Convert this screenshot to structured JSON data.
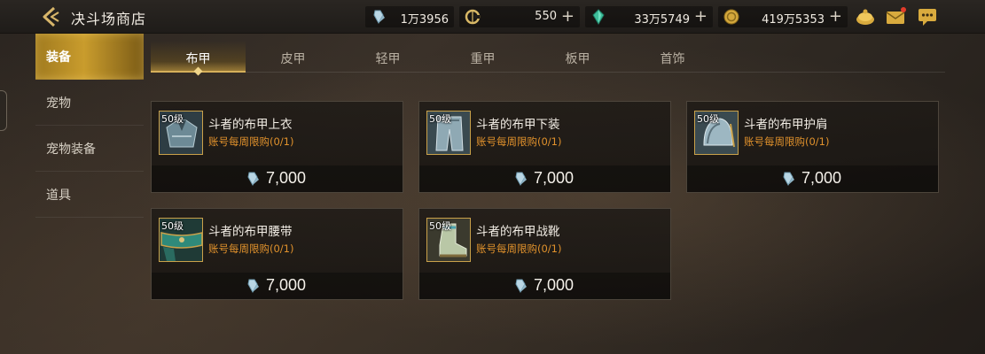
{
  "header": {
    "title": "决斗场商店",
    "currencies": [
      {
        "icon": "crystal-icon",
        "value": "1万3956",
        "plus": false
      },
      {
        "icon": "coin-c-icon",
        "value": "550",
        "plus": true
      },
      {
        "icon": "gem-icon",
        "value": "33万5749",
        "plus": true
      },
      {
        "icon": "gold-icon",
        "value": "419万5353",
        "plus": true
      }
    ]
  },
  "sidebar": {
    "items": [
      {
        "label": "装备",
        "active": true
      },
      {
        "label": "宠物",
        "active": false
      },
      {
        "label": "宠物装备",
        "active": false
      },
      {
        "label": "道具",
        "active": false
      }
    ]
  },
  "tabs": [
    {
      "label": "布甲",
      "active": true
    },
    {
      "label": "皮甲",
      "active": false
    },
    {
      "label": "轻甲",
      "active": false
    },
    {
      "label": "重甲",
      "active": false
    },
    {
      "label": "板甲",
      "active": false
    },
    {
      "label": "首饰",
      "active": false
    }
  ],
  "items": [
    {
      "level": "50级",
      "name": "斗者的布甲上衣",
      "limit": "账号每周限购(0/1)",
      "price": "7,000",
      "price_icon": "crystal-icon"
    },
    {
      "level": "50级",
      "name": "斗者的布甲下装",
      "limit": "账号每周限购(0/1)",
      "price": "7,000",
      "price_icon": "crystal-icon"
    },
    {
      "level": "50级",
      "name": "斗者的布甲护肩",
      "limit": "账号每周限购(0/1)",
      "price": "7,000",
      "price_icon": "crystal-icon"
    },
    {
      "level": "50级",
      "name": "斗者的布甲腰带",
      "limit": "账号每周限购(0/1)",
      "price": "7,000",
      "price_icon": "crystal-icon"
    },
    {
      "level": "50级",
      "name": "斗者的布甲战靴",
      "limit": "账号每周限购(0/1)",
      "price": "7,000",
      "price_icon": "crystal-icon"
    }
  ],
  "colors": {
    "accent_gold": "#c99c2d",
    "limit_orange": "#e0912c"
  }
}
